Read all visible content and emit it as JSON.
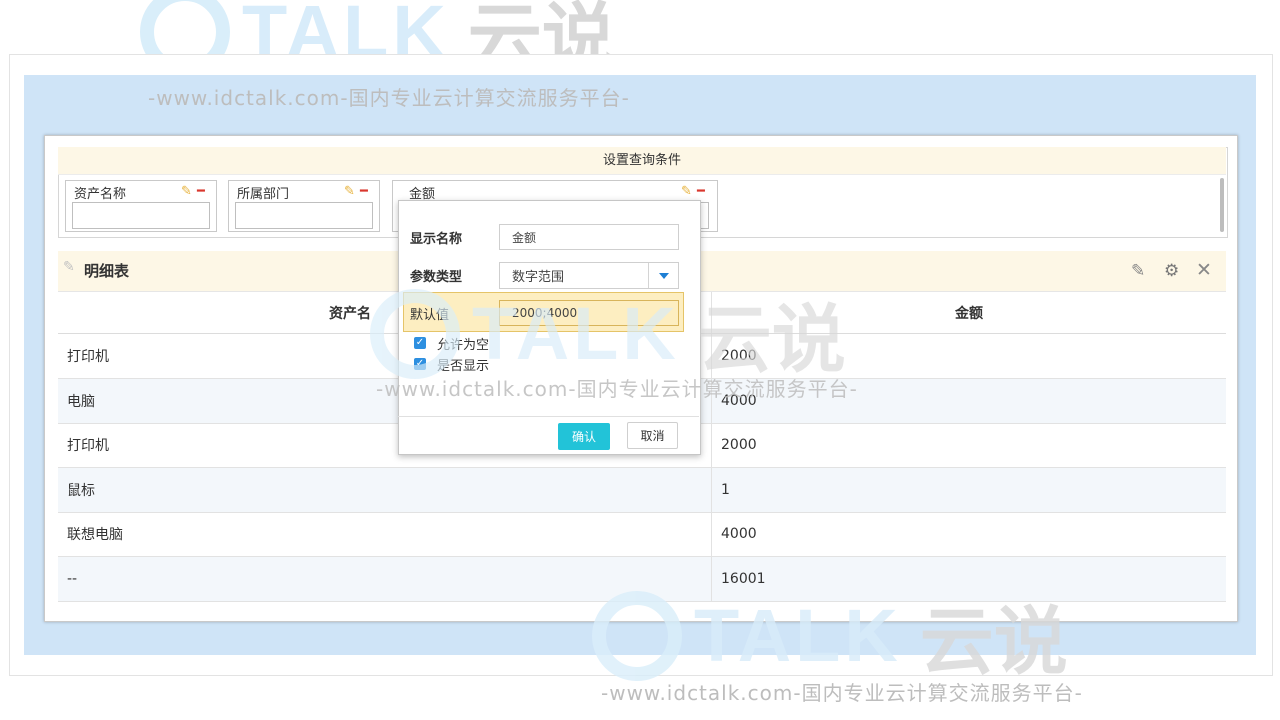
{
  "watermark": {
    "brand": "TALK",
    "cn": "云说",
    "url": "-www.idctalk.com-国内专业云计算交流服务平台-"
  },
  "query": {
    "title": "设置查询条件",
    "fields": [
      {
        "label": "资产名称",
        "value": ""
      },
      {
        "label": "所属部门",
        "value": ""
      },
      {
        "label": "金额",
        "value": ""
      }
    ]
  },
  "detail": {
    "title": "明细表",
    "columns": [
      "资产名",
      "金额"
    ],
    "rows": [
      {
        "name": "打印机",
        "amount": "2000"
      },
      {
        "name": "电脑",
        "amount": "4000"
      },
      {
        "name": "打印机",
        "amount": "2000"
      },
      {
        "name": "鼠标",
        "amount": "1"
      },
      {
        "name": "联想电脑",
        "amount": "4000"
      },
      {
        "name": "--",
        "amount": "16001"
      }
    ]
  },
  "popup": {
    "display_name_label": "显示名称",
    "display_name_value": "金额",
    "param_type_label": "参数类型",
    "param_type_value": "数字范围",
    "default_label": "默认值",
    "default_value": "2000;4000",
    "allow_empty_label": "允许为空",
    "allow_empty_checked": true,
    "show_label": "是否显示",
    "show_checked": true,
    "ok_label": "确认",
    "cancel_label": "取消"
  },
  "icons": {
    "edit": "edit-icon",
    "remove": "minus-icon",
    "settings": "gear-icon",
    "close": "close-icon",
    "dropdown": "chevron-down-icon"
  },
  "colors": {
    "accent": "#22c3d8",
    "checkbox": "#2d8fe0",
    "delete": "#d9362d",
    "edit": "#e7b23c",
    "panel_bg": "#cfe4f7",
    "header_bg": "#fdf7e6"
  }
}
